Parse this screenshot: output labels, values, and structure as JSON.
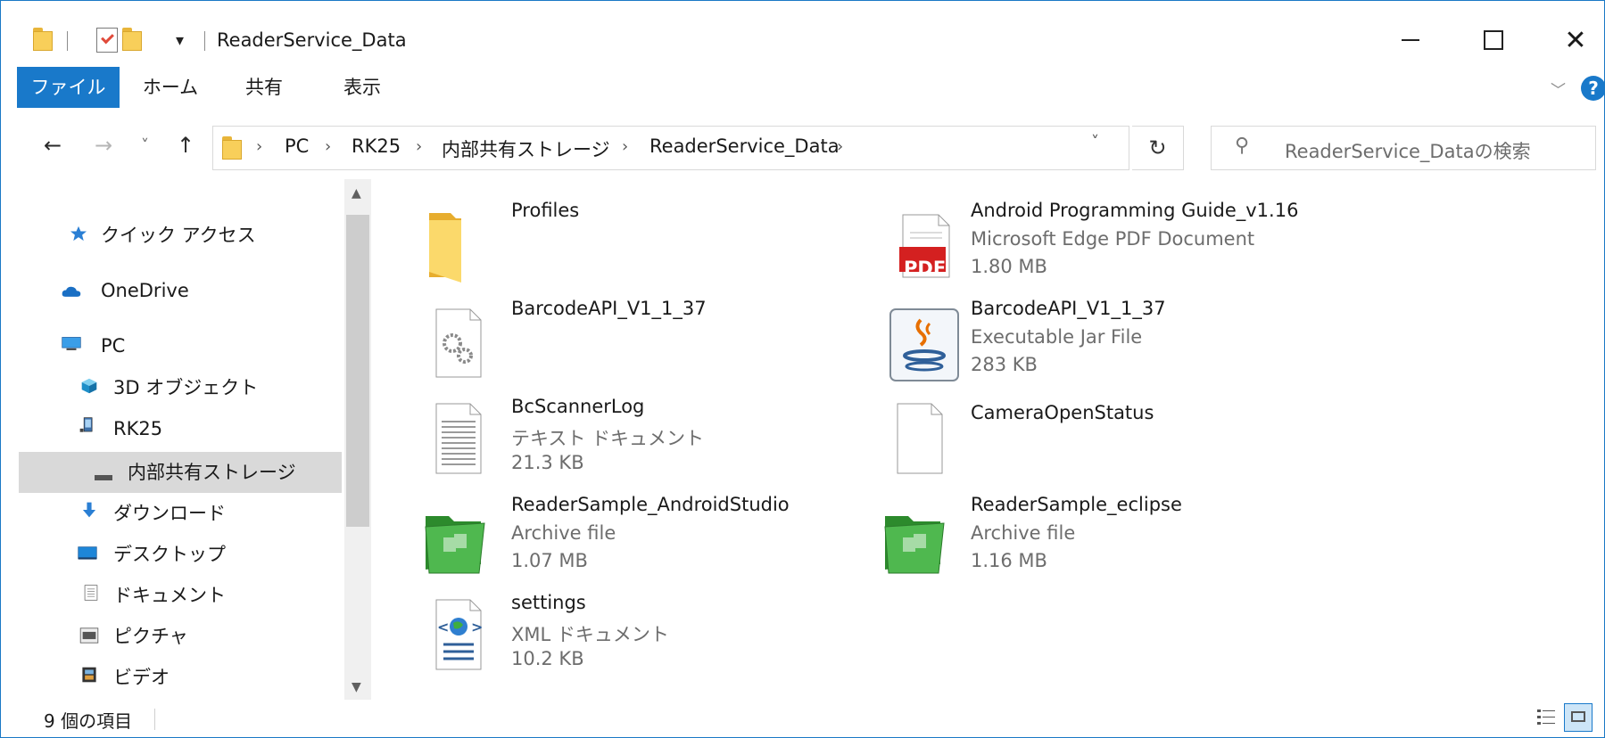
{
  "window": {
    "title": "ReaderService_Data",
    "quick_access_dropdown": "▾",
    "controls": {
      "minimize": "",
      "maximize": "",
      "close": "✕"
    }
  },
  "ribbon": {
    "tabs": [
      {
        "label": "ファイル",
        "active": true
      },
      {
        "label": "ホーム"
      },
      {
        "label": "共有"
      },
      {
        "label": "表示"
      }
    ],
    "expand_icon": "chevron-down-icon",
    "help_label": "?"
  },
  "navigation": {
    "back": "←",
    "forward": "→",
    "recent": "˅",
    "up": "↑",
    "breadcrumb": [
      "PC",
      "RK25",
      "内部共有ストレージ",
      "ReaderService_Data"
    ],
    "breadcrumb_separator": "›",
    "dropdown": "˅",
    "refresh": "↻",
    "search_placeholder": "ReaderService_Dataの検索"
  },
  "nav_pane": {
    "items": [
      {
        "label": "クイック アクセス",
        "icon": "star-icon"
      },
      {
        "label": "OneDrive",
        "icon": "cloud-icon"
      },
      {
        "label": "PC",
        "icon": "computer-icon"
      },
      {
        "label": "3D オブジェクト",
        "icon": "cube-icon"
      },
      {
        "label": "RK25",
        "icon": "device-icon"
      },
      {
        "label": "内部共有ストレージ",
        "icon": "drive-icon",
        "selected": true
      },
      {
        "label": "ダウンロード",
        "icon": "download-icon"
      },
      {
        "label": "デスクトップ",
        "icon": "desktop-icon"
      },
      {
        "label": "ドキュメント",
        "icon": "document-icon"
      },
      {
        "label": "ピクチャ",
        "icon": "picture-icon"
      },
      {
        "label": "ビデオ",
        "icon": "video-icon"
      }
    ]
  },
  "files": [
    {
      "name": "Profiles",
      "type": "",
      "size": "",
      "icon": "folder-icon"
    },
    {
      "name": "Android Programming Guide_v1.16",
      "type": "Microsoft Edge PDF Document",
      "size": "1.80 MB",
      "icon": "pdf-icon",
      "badge": "PDF"
    },
    {
      "name": "BarcodeAPI_V1_1_37",
      "type": "",
      "size": "",
      "icon": "settings-file-icon"
    },
    {
      "name": "BarcodeAPI_V1_1_37",
      "type": "Executable Jar File",
      "size": "283 KB",
      "icon": "java-jar-icon"
    },
    {
      "name": "BcScannerLog",
      "type": "テキスト ドキュメント",
      "size": "21.3 KB",
      "icon": "text-file-icon"
    },
    {
      "name": "CameraOpenStatus",
      "type": "",
      "size": "",
      "icon": "blank-file-icon"
    },
    {
      "name": "ReaderSample_AndroidStudio",
      "type": "Archive file",
      "size": "1.07 MB",
      "icon": "archive-icon"
    },
    {
      "name": "ReaderSample_eclipse",
      "type": "Archive file",
      "size": "1.16 MB",
      "icon": "archive-icon"
    },
    {
      "name": "settings",
      "type": "XML ドキュメント",
      "size": "10.2 KB",
      "icon": "xml-file-icon"
    }
  ],
  "status": {
    "item_count": "9 個の項目"
  },
  "colors": {
    "accent": "#1979ca",
    "selected_bg": "#d9d9d9",
    "folder": "#f8cf5a",
    "pdf_red": "#d42020",
    "archive_green": "#3f9f3f"
  }
}
